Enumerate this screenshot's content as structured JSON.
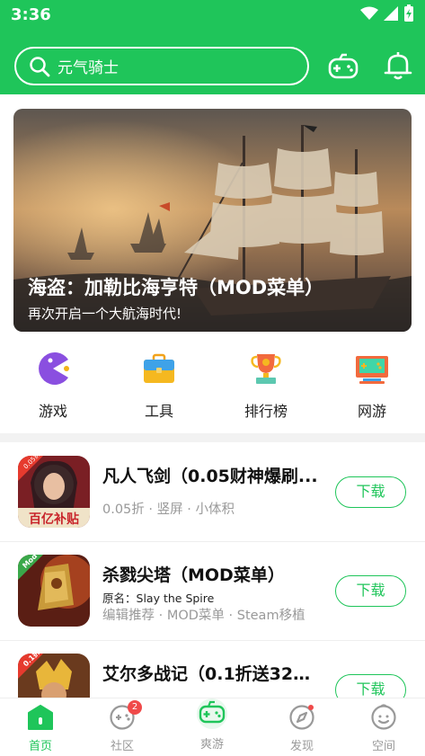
{
  "status": {
    "time": "3:36"
  },
  "search": {
    "text": "元气骑士"
  },
  "banner": {
    "title": "海盗：加勒比海亨特（MOD菜单）",
    "subtitle": "再次开启一个大航海时代!"
  },
  "categories": [
    {
      "label": "游戏",
      "icon": "pacman-icon"
    },
    {
      "label": "工具",
      "icon": "toolbox-icon"
    },
    {
      "label": "排行榜",
      "icon": "trophy-icon"
    },
    {
      "label": "网游",
      "icon": "retro-console-icon"
    }
  ],
  "apps": [
    {
      "name": "凡人飞剑（0.05财神爆刷...",
      "meta": "0.05折 · 竖屏 · 小体积",
      "badge": "0.05折",
      "thumb_text": "百亿补贴",
      "download": "下载"
    },
    {
      "name": "杀戮尖塔（MOD菜单）",
      "origin_label": "原名：",
      "origin": "Slay the Spire",
      "meta": "编辑推荐 · MOD菜单 · Steam移植",
      "badge": "Mod",
      "download": "下载"
    },
    {
      "name": "艾尔多战记（0.1折送3280...",
      "badge": "0.1折",
      "download": "下载"
    }
  ],
  "tabs": [
    {
      "label": "首页",
      "icon": "home-icon"
    },
    {
      "label": "社区",
      "icon": "community-icon",
      "badge": "2"
    },
    {
      "label": "爽游",
      "icon": "gamepad-icon"
    },
    {
      "label": "发现",
      "icon": "compass-icon"
    },
    {
      "label": "空间",
      "icon": "profile-icon"
    }
  ],
  "colors": {
    "accent": "#1fc55a",
    "badge": "#f04a4a"
  }
}
